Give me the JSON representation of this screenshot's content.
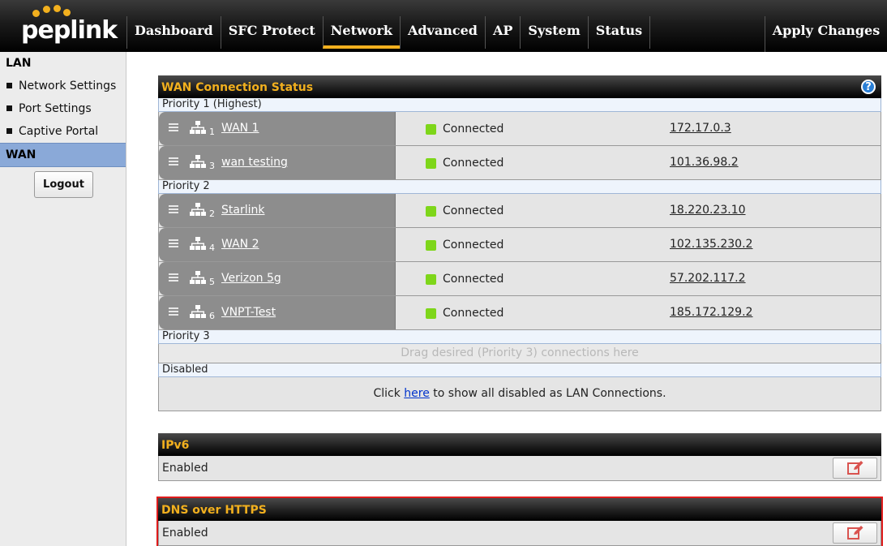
{
  "brand": {
    "logo_text": "peplink"
  },
  "nav": {
    "items": [
      {
        "label": "Dashboard"
      },
      {
        "label": "SFC Protect"
      },
      {
        "label": "Network"
      },
      {
        "label": "Advanced"
      },
      {
        "label": "AP"
      },
      {
        "label": "System"
      },
      {
        "label": "Status"
      }
    ],
    "active": "Network",
    "apply_label": "Apply Changes"
  },
  "sidebar": {
    "lan_heading": "LAN",
    "items": [
      {
        "label": "Network Settings"
      },
      {
        "label": "Port Settings"
      },
      {
        "label": "Captive Portal"
      }
    ],
    "wan_heading": "WAN",
    "logout_label": "Logout"
  },
  "wan_status": {
    "title": "WAN Connection Status",
    "help_glyph": "?",
    "priority1": {
      "label": "Priority 1 (Highest)",
      "connections": [
        {
          "num": "1",
          "name": "WAN 1",
          "status": "Connected",
          "ip": "172.17.0.3"
        },
        {
          "num": "3",
          "name": "wan testing",
          "status": "Connected",
          "ip": "101.36.98.2"
        }
      ]
    },
    "priority2": {
      "label": "Priority 2",
      "connections": [
        {
          "num": "2",
          "name": "Starlink",
          "status": "Connected",
          "ip": "18.220.23.10"
        },
        {
          "num": "4",
          "name": "WAN 2",
          "status": "Connected",
          "ip": "102.135.230.2"
        },
        {
          "num": "5",
          "name": "Verizon 5g",
          "status": "Connected",
          "ip": "57.202.117.2"
        },
        {
          "num": "6",
          "name": "VNPT-Test",
          "status": "Connected",
          "ip": "185.172.129.2"
        }
      ]
    },
    "priority3": {
      "label": "Priority 3",
      "drag_hint": "Drag desired (Priority 3) connections here"
    },
    "disabled": {
      "label": "Disabled",
      "text_before": "Click ",
      "link": "here",
      "text_after": " to show all disabled as LAN Connections."
    }
  },
  "ipv6": {
    "title": "IPv6",
    "value": "Enabled"
  },
  "doh": {
    "title": "DNS over HTTPS",
    "value": "Enabled"
  },
  "colors": {
    "accent": "#f2b01e",
    "connected": "#7ed61a",
    "highlight": "#e01b1b",
    "sidebar_active": "#8aa9d8"
  }
}
